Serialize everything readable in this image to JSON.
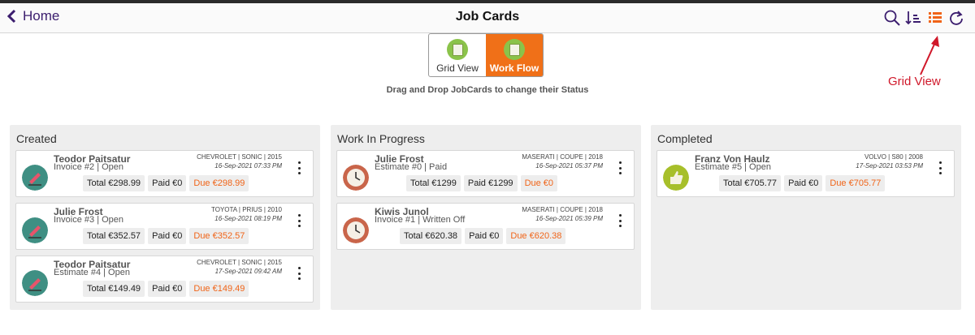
{
  "header": {
    "back_label": "Home",
    "title": "Job Cards"
  },
  "toggle": {
    "grid_label": "Grid View",
    "flow_label": "Work Flow",
    "active": "Work Flow"
  },
  "hint": "Drag and Drop JobCards to change their Status",
  "annotation": {
    "label": "Grid View",
    "color": "#d0182a"
  },
  "colors": {
    "accent": "#f07018",
    "due": "#f06418",
    "nav": "#3b1d6e"
  },
  "columns": [
    {
      "title": "Created",
      "cards": [
        {
          "name": "Teodor Paitsatur",
          "doc": "Invoice #2 | Open",
          "vehicle": "CHEVROLET | SONIC | 2015",
          "date": "16-Sep-2021 07:33 PM",
          "total": "Total €298.99",
          "paid": "Paid €0",
          "due": "Due €298.99",
          "icon": "pencil-icon"
        },
        {
          "name": "Julie Frost",
          "doc": "Invoice #3 | Open",
          "vehicle": "TOYOTA | PRIUS | 2010",
          "date": "16-Sep-2021 08:19 PM",
          "total": "Total €352.57",
          "paid": "Paid €0",
          "due": "Due €352.57",
          "icon": "pencil-icon"
        },
        {
          "name": "Teodor Paitsatur",
          "doc": "Estimate #4 | Open",
          "vehicle": "CHEVROLET | SONIC | 2015",
          "date": "17-Sep-2021 09:42 AM",
          "total": "Total €149.49",
          "paid": "Paid €0",
          "due": "Due €149.49",
          "icon": "pencil-icon"
        }
      ]
    },
    {
      "title": "Work In Progress",
      "cards": [
        {
          "name": "Julie Frost",
          "doc": "Estimate #0 | Paid",
          "vehicle": "MASERATI | COUPE | 2018",
          "date": "16-Sep-2021 05:37 PM",
          "total": "Total €1299",
          "paid": "Paid €1299",
          "due": "Due €0",
          "icon": "clock-icon"
        },
        {
          "name": "Kiwis Junol",
          "doc": "Invoice #1 | Written Off",
          "vehicle": "MASERATI | COUPE | 2018",
          "date": "16-Sep-2021 05:39 PM",
          "total": "Total €620.38",
          "paid": "Paid €0",
          "due": "Due €620.38",
          "icon": "clock-icon"
        }
      ]
    },
    {
      "title": "Completed",
      "cards": [
        {
          "name": "Franz Von Haulz",
          "doc": "Estimate #5 | Open",
          "vehicle": "VOLVO | S80 | 2008",
          "date": "17-Sep-2021 03:53 PM",
          "total": "Total €705.77",
          "paid": "Paid €0",
          "due": "Due €705.77",
          "icon": "thumbs-up-icon"
        }
      ]
    }
  ]
}
